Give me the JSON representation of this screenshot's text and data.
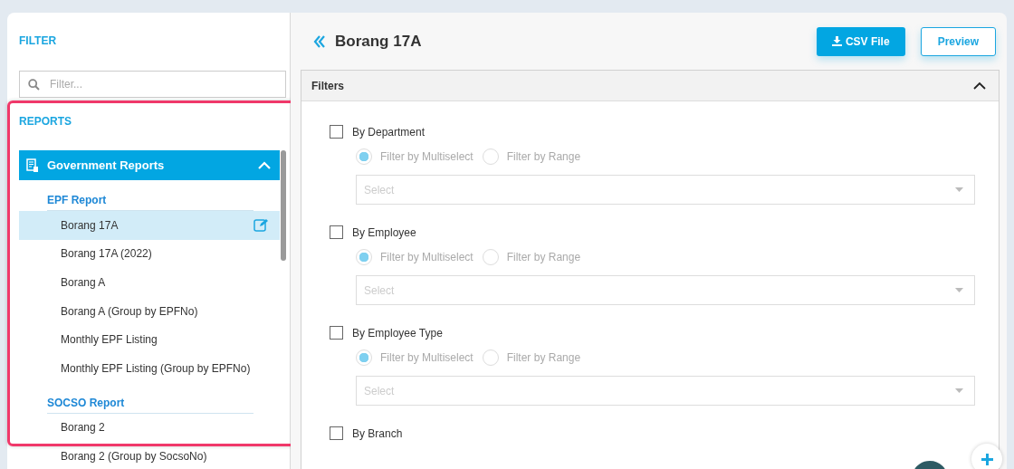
{
  "sidebar": {
    "filter_heading": "FILTER",
    "search": {
      "placeholder": "Filter..."
    },
    "reports_heading": "REPORTS",
    "groups": [
      {
        "title": "Government Reports",
        "expanded": true,
        "sections": [
          {
            "title": "EPF Report",
            "items": [
              {
                "label": "Borang 17A",
                "selected": true
              },
              {
                "label": "Borang 17A (2022)",
                "selected": false
              },
              {
                "label": "Borang A",
                "selected": false
              },
              {
                "label": "Borang A (Group by EPFNo)",
                "selected": false
              },
              {
                "label": "Monthly EPF Listing",
                "selected": false
              },
              {
                "label": "Monthly EPF Listing (Group by EPFNo)",
                "selected": false
              }
            ]
          },
          {
            "title": "SOCSO Report",
            "items": [
              {
                "label": "Borang 2",
                "selected": false
              },
              {
                "label": "Borang 2 (Group by SocsoNo)",
                "selected": false
              }
            ]
          }
        ]
      }
    ]
  },
  "header": {
    "title": "Borang 17A",
    "buttons": [
      {
        "label": "CSV File",
        "kind": "primary"
      },
      {
        "label": "Preview",
        "kind": "outline"
      }
    ]
  },
  "filters_panel": {
    "title": "Filters",
    "expanded": true,
    "filters": [
      {
        "label": "By Department",
        "checked": false,
        "options": [
          {
            "label": "Filter by Multiselect",
            "selected": true
          },
          {
            "label": "Filter by Range",
            "selected": false
          }
        ],
        "select": {
          "placeholder": "Select"
        }
      },
      {
        "label": "By Employee",
        "checked": false,
        "options": [
          {
            "label": "Filter by Multiselect",
            "selected": true
          },
          {
            "label": "Filter by Range",
            "selected": false
          }
        ],
        "select": {
          "placeholder": "Select"
        }
      },
      {
        "label": "By Employee Type",
        "checked": false,
        "options": [
          {
            "label": "Filter by Multiselect",
            "selected": true
          },
          {
            "label": "Filter by Range",
            "selected": false
          }
        ],
        "select": {
          "placeholder": "Select"
        }
      },
      {
        "label": "By Branch",
        "checked": false
      }
    ]
  }
}
